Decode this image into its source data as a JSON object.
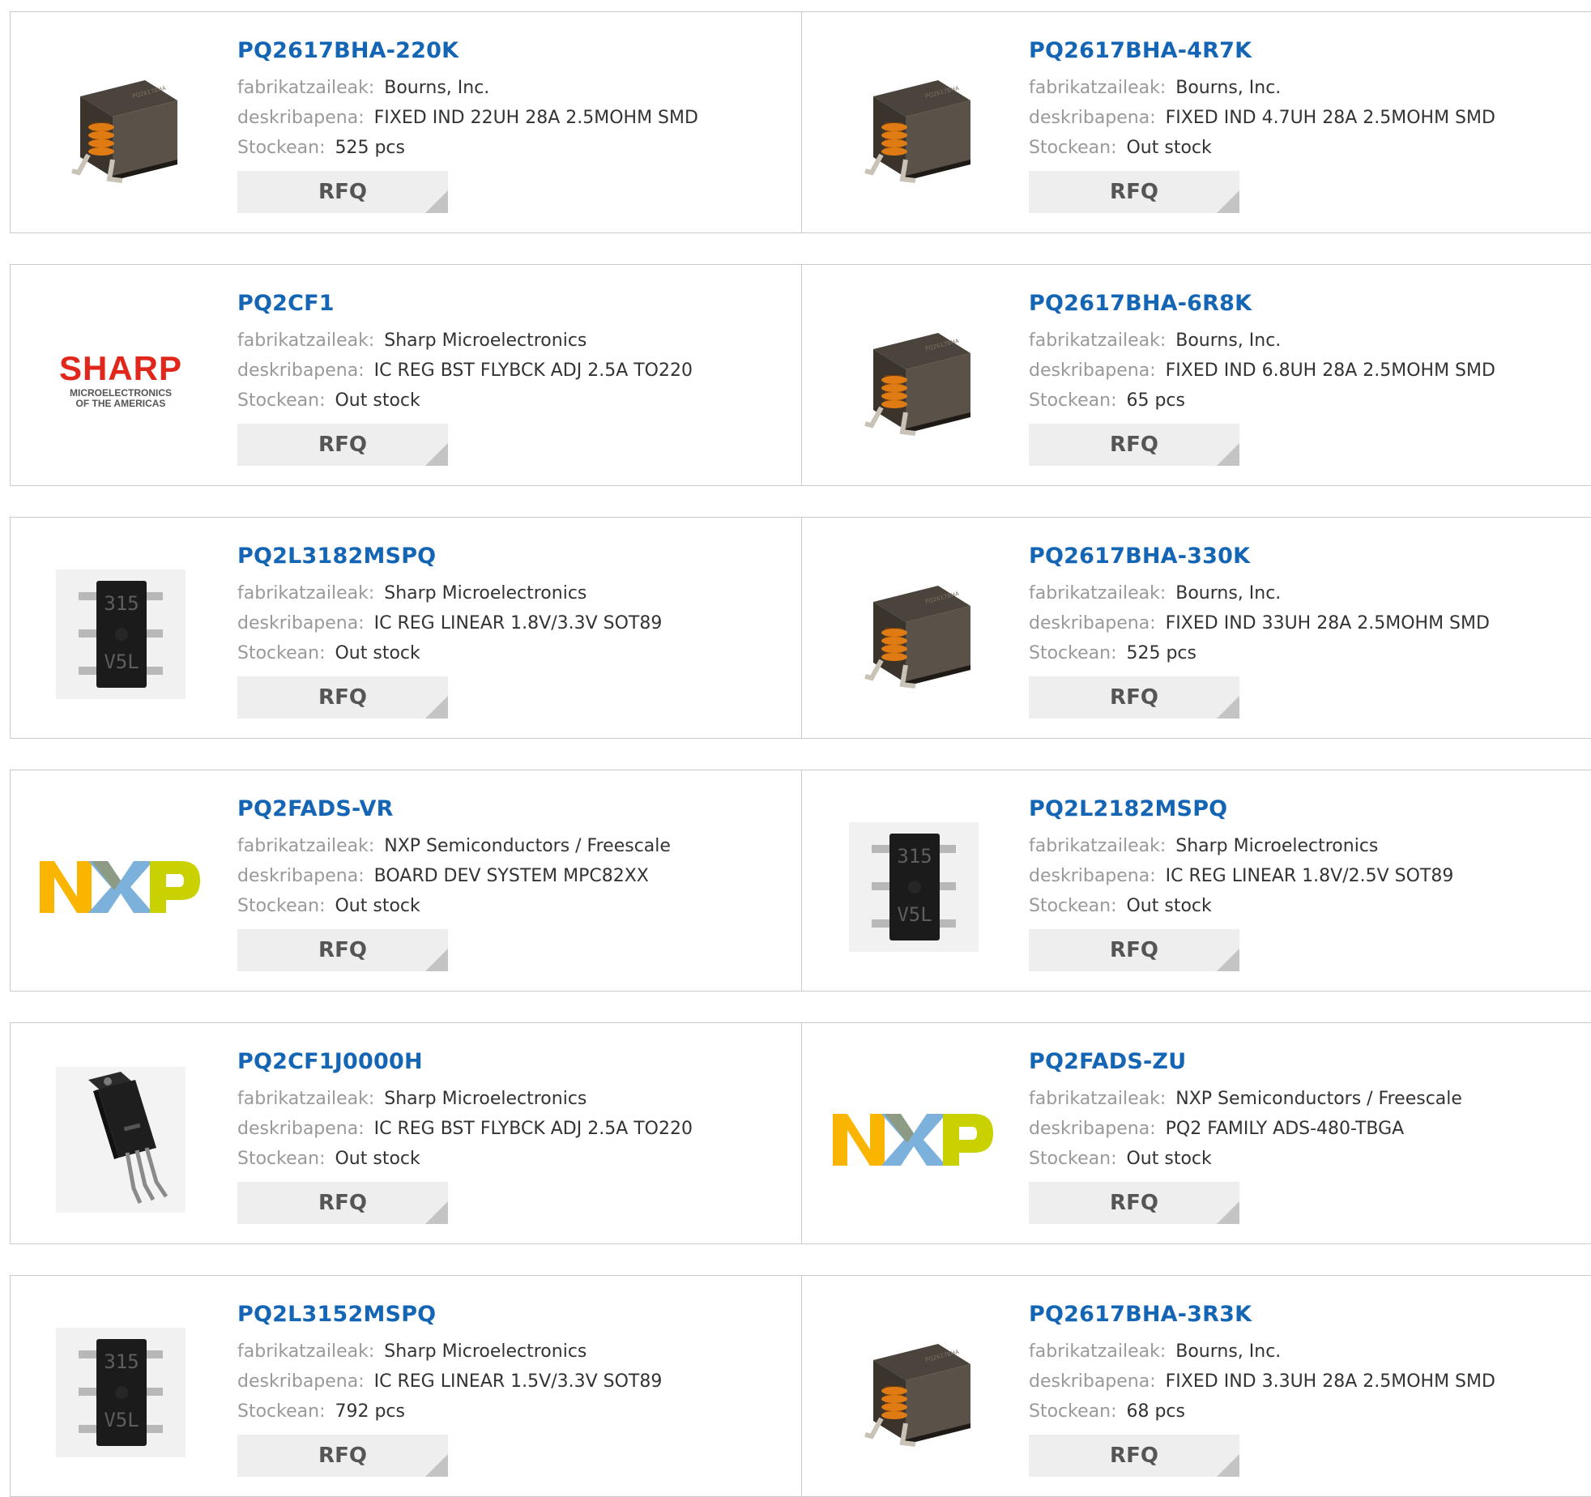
{
  "labels": {
    "manufacturer": "fabrikatzaileak:",
    "description": "deskribapena:",
    "stock": "Stockean:",
    "rfq": "RFQ"
  },
  "colors": {
    "link": "#1565b5",
    "label": "#999999",
    "value": "#333333",
    "rfq_bg": "#eeeeee",
    "border": "#c9c9c9",
    "sharp_red": "#e1261c",
    "nxp_orange": "#f9b500",
    "nxp_blue": "#7bb1db",
    "nxp_green": "#c9d200"
  },
  "sharp_logo": {
    "main": "SHARP",
    "line1": "MICROELECTRONICS",
    "line2": "OF THE AMERICAS"
  },
  "products": [
    {
      "part": "PQ2617BHA-220K",
      "manufacturer": "Bourns, Inc.",
      "description": "FIXED IND 22UH 28A 2.5MOHM SMD",
      "stock": "525 pcs",
      "image": "inductor-image"
    },
    {
      "part": "PQ2617BHA-4R7K",
      "manufacturer": "Bourns, Inc.",
      "description": "FIXED IND 4.7UH 28A 2.5MOHM SMD",
      "stock": "Out stock",
      "image": "inductor-image"
    },
    {
      "part": "PQ2CF1",
      "manufacturer": "Sharp Microelectronics",
      "description": "IC REG BST FLYBCK ADJ 2.5A TO220",
      "stock": "Out stock",
      "image": "sharp-logo"
    },
    {
      "part": "PQ2617BHA-6R8K",
      "manufacturer": "Bourns, Inc.",
      "description": "FIXED IND 6.8UH 28A 2.5MOHM SMD",
      "stock": "65 pcs",
      "image": "inductor-image"
    },
    {
      "part": "PQ2L3182MSPQ",
      "manufacturer": "Sharp Microelectronics",
      "description": "IC REG LINEAR 1.8V/3.3V SOT89",
      "stock": "Out stock",
      "image": "sot89-chip-image"
    },
    {
      "part": "PQ2617BHA-330K",
      "manufacturer": "Bourns, Inc.",
      "description": "FIXED IND 33UH 28A 2.5MOHM SMD",
      "stock": "525 pcs",
      "image": "inductor-image"
    },
    {
      "part": "PQ2FADS-VR",
      "manufacturer": "NXP Semiconductors / Freescale",
      "description": "BOARD DEV SYSTEM MPC82XX",
      "stock": "Out stock",
      "image": "nxp-logo"
    },
    {
      "part": "PQ2L2182MSPQ",
      "manufacturer": "Sharp Microelectronics",
      "description": "IC REG LINEAR 1.8V/2.5V SOT89",
      "stock": "Out stock",
      "image": "sot89-chip-image"
    },
    {
      "part": "PQ2CF1J0000H",
      "manufacturer": "Sharp Microelectronics",
      "description": "IC REG BST FLYBCK ADJ 2.5A TO220",
      "stock": "Out stock",
      "image": "to220-package-image"
    },
    {
      "part": "PQ2FADS-ZU",
      "manufacturer": "NXP Semiconductors / Freescale",
      "description": "PQ2 FAMILY ADS-480-TBGA",
      "stock": "Out stock",
      "image": "nxp-logo"
    },
    {
      "part": "PQ2L3152MSPQ",
      "manufacturer": "Sharp Microelectronics",
      "description": "IC REG LINEAR 1.5V/3.3V SOT89",
      "stock": "792 pcs",
      "image": "sot89-chip-image"
    },
    {
      "part": "PQ2617BHA-3R3K",
      "manufacturer": "Bourns, Inc.",
      "description": "FIXED IND 3.3UH 28A 2.5MOHM SMD",
      "stock": "68 pcs",
      "image": "inductor-image"
    }
  ]
}
